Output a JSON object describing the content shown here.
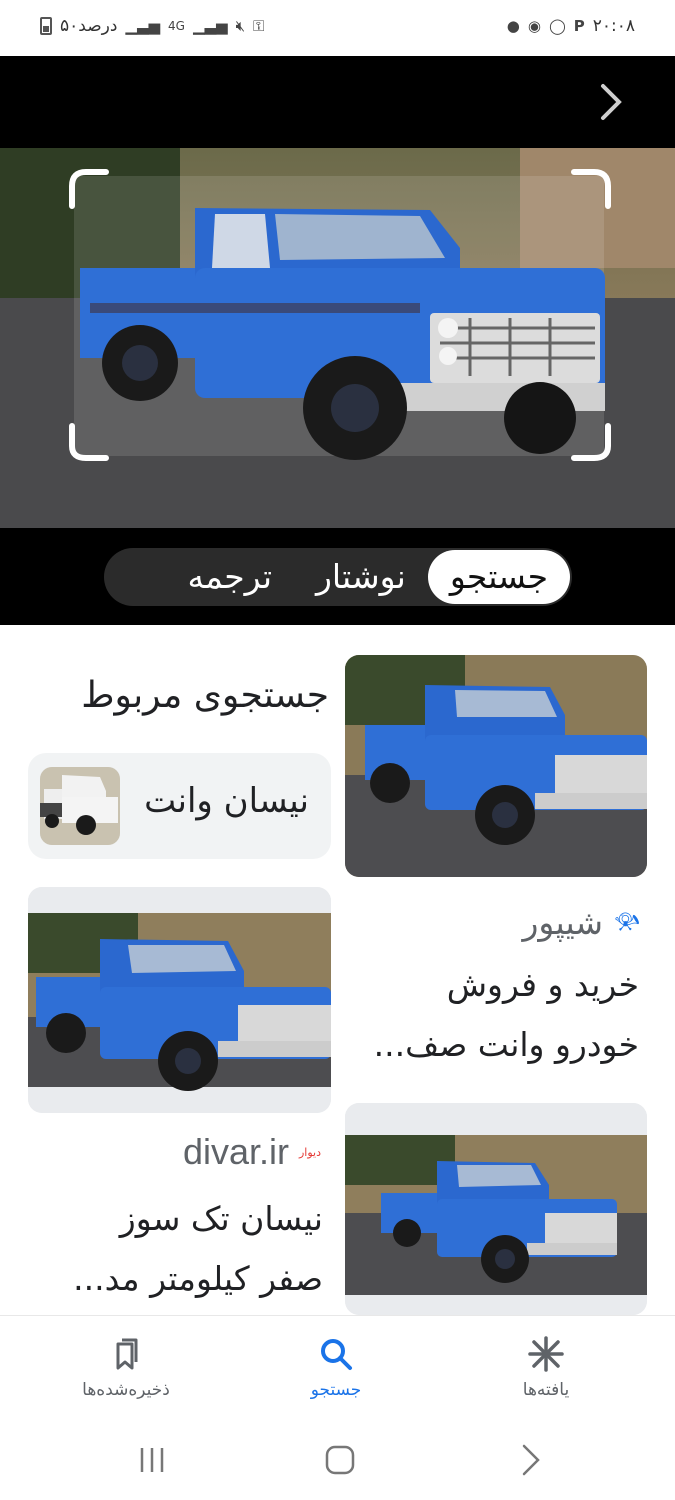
{
  "status_bar": {
    "time": "۲۰:۰۸",
    "battery_text": "۵۰درصد",
    "network": "4G",
    "icons": [
      "battery-icon",
      "signal-icon",
      "mute-icon",
      "vpn-key-icon",
      "dot-icon",
      "chrome-icon",
      "whatsapp-icon",
      "p-app-icon"
    ]
  },
  "lens": {
    "tabs": [
      {
        "label": "جستجو",
        "active": true
      },
      {
        "label": "نوشتار",
        "active": false
      },
      {
        "label": "ترجمه",
        "active": false
      }
    ]
  },
  "results": {
    "related_title": "جستجوی مربوط",
    "related_chip_label": "نیسان وانت",
    "items": [
      {
        "source": "شیپور",
        "desc_line1": "خرید و فروش",
        "desc_line2": "خودرو وانت صف..."
      },
      {
        "source": "divar.ir",
        "source_badge": "دیوار",
        "desc_line1": "نیسان تک سوز",
        "desc_line2": "صفر کیلومتر مد..."
      }
    ]
  },
  "bottom_nav": {
    "items": [
      {
        "label": "ذخیره‌شده‌ها",
        "icon": "saved-icon",
        "active": false
      },
      {
        "label": "جستجو",
        "icon": "search-icon",
        "active": true
      },
      {
        "label": "یافته‌ها",
        "icon": "discover-icon",
        "active": false
      }
    ]
  },
  "colors": {
    "truck_blue": "#2f6fd6",
    "accent_blue": "#1a73e8",
    "lens_black": "#000000"
  }
}
